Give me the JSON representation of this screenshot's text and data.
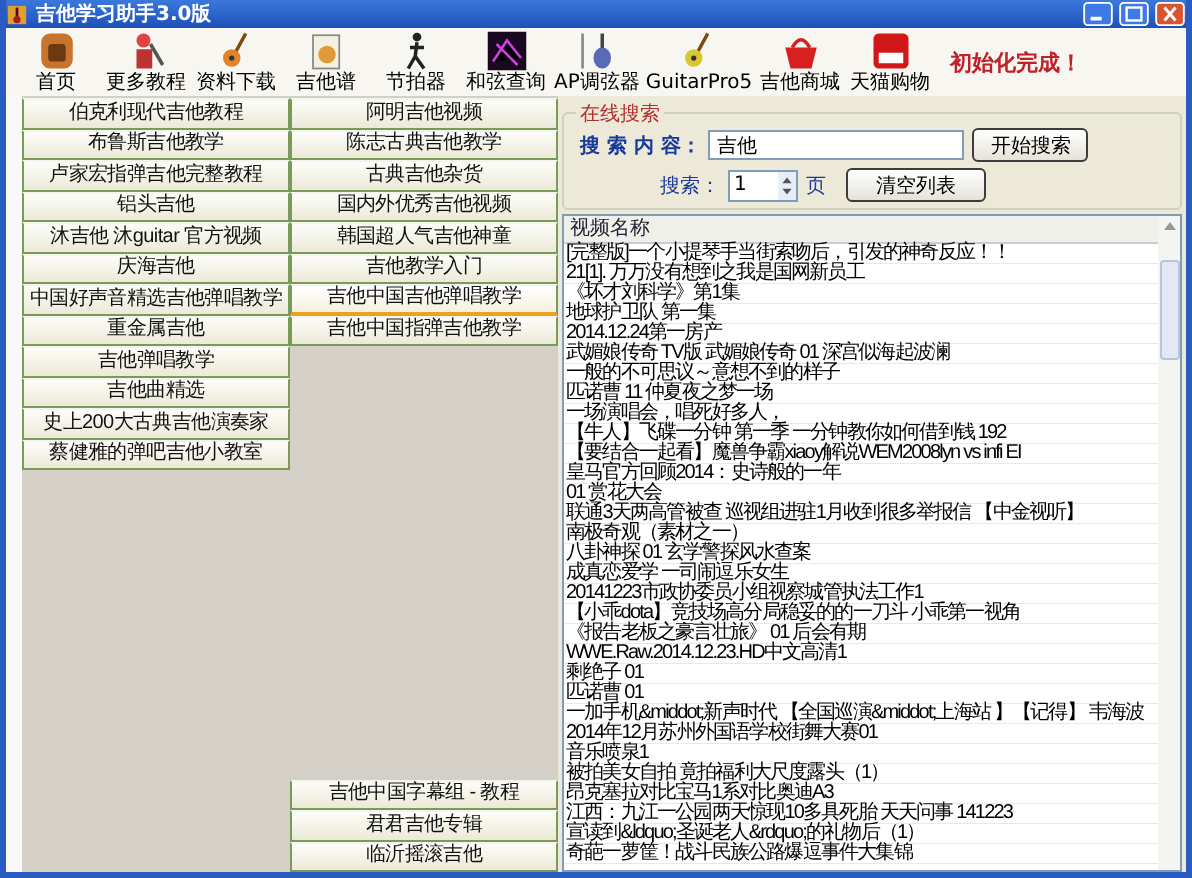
{
  "window": {
    "title": "吉他学习助手3.0版"
  },
  "toolbar": {
    "items": [
      {
        "label": "首页"
      },
      {
        "label": "更多教程"
      },
      {
        "label": "资料下载"
      },
      {
        "label": "吉他谱"
      },
      {
        "label": "节拍器"
      },
      {
        "label": "和弦查询"
      },
      {
        "label": "AP调弦器"
      },
      {
        "label": "GuitarPro5"
      },
      {
        "label": "吉他商城"
      },
      {
        "label": "天猫购物"
      }
    ],
    "status": "初始化完成！"
  },
  "left_buttons": [
    {
      "label": "伯克利现代吉他教程",
      "selected": false
    },
    {
      "label": "布鲁斯吉他教学",
      "selected": false
    },
    {
      "label": "卢家宏指弹吉他完整教程",
      "selected": false
    },
    {
      "label": "铝头吉他",
      "selected": false
    },
    {
      "label": "沐吉他 沐guitar 官方视频",
      "selected": false
    },
    {
      "label": "庆海吉他",
      "selected": false
    },
    {
      "label": "中国好声音精选吉他弹唱教学",
      "selected": false
    },
    {
      "label": "重金属吉他",
      "selected": false
    },
    {
      "label": "吉他弹唱教学",
      "selected": false
    },
    {
      "label": "吉他曲精选",
      "selected": false
    },
    {
      "label": "史上200大古典吉他演奏家",
      "selected": false
    },
    {
      "label": "蔡健雅的弹吧吉他小教室",
      "selected": false
    }
  ],
  "right_buttons": [
    {
      "label": "阿明吉他视频",
      "selected": false
    },
    {
      "label": "陈志古典吉他教学",
      "selected": false
    },
    {
      "label": "古典吉他杂货",
      "selected": false
    },
    {
      "label": "国内外优秀吉他视频",
      "selected": false
    },
    {
      "label": "韩国超人气吉他神童",
      "selected": false
    },
    {
      "label": "吉他教学入门",
      "selected": false
    },
    {
      "label": "吉他中国吉他弹唱教学",
      "selected": true
    },
    {
      "label": "吉他中国指弹吉他教学",
      "selected": false
    }
  ],
  "bottom_buttons": [
    {
      "label": "吉他中国字幕组 - 教程",
      "selected": false
    },
    {
      "label": "君君吉他专辑",
      "selected": false
    },
    {
      "label": "临沂摇滚吉他",
      "selected": false
    }
  ],
  "search": {
    "group_title": "在线搜索",
    "query_label": "搜 索 内 容：",
    "query_value": "吉他",
    "search_button": "开始搜索",
    "page_label": "搜索：",
    "page_value": "1",
    "page_unit": "页",
    "clear_button": "清空列表"
  },
  "video_list": {
    "column": "视频名称",
    "rows": [
      "[完整版]一个小提琴手当街索吻后，引发的神奇反应！！",
      "21[1]. 万万没有想到之我是国网新员工",
      "《坏才刘科学》第1集",
      "地球护卫队 第一集",
      "2014.12.24第一房产",
      "武媚娘传奇 TV版 武媚娘传奇 01 深宫似海起波澜",
      "一般的不可思议～意想不到的样子",
      "匹诺曹 11 仲夏夜之梦一场",
      "一场演唱会，唱死好多人，",
      "【牛人】飞碟一分钟 第一季 一分钟教你如何借到钱 192",
      "【要结合一起看】魔兽争霸xiaoy解说WEM2008lyn vs infi EI",
      "皇马官方回顾2014：史诗般的一年",
      "01 赏花大会",
      "联通3天两高管被查 巡视组进驻1月收到很多举报信 【中金视听】",
      "南极奇观（素材之一）",
      "八卦神探 01 玄学警探风水查案",
      "成真恋爱学 一司闹逗乐女生",
      "20141223市政协委员小组视察城管执法工作1",
      "【小乖dota】竞技场高分局稳妥的的一刀斗 小乖第一视角",
      "《报告老板之豪言壮旅》 01 后会有期",
      "WWE.Raw.2014.12.23.HD中文高清1",
      "剩绝子 01",
      "匹诺曹 01",
      "一加手机&middot;新声时代 【全国巡演&middot;上海站 】【记得】 韦海波",
      "2014年12月苏州外国语学校街舞大赛01",
      "音乐喷泉1",
      "被拍美女自拍 竟拍福利大尺度露头（1）",
      "昂克塞拉对比宝马1系对比奥迪A3",
      "江西：九江一公园两天惊现10多具死胎 天天问事 141223",
      "宣读到&ldquo;圣诞老人&rdquo;的礼物后（1）",
      "奇葩一萝筐！战斗民族公路爆逗事件大集锦"
    ]
  }
}
